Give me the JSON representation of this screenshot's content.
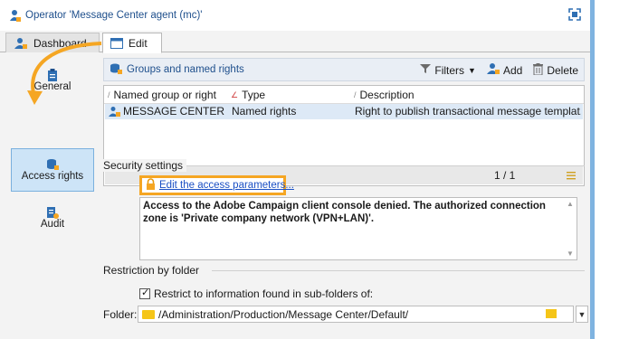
{
  "window": {
    "title": "Operator 'Message Center agent (mc)'"
  },
  "tabs": [
    {
      "label": "Dashboard"
    },
    {
      "label": "Edit"
    }
  ],
  "sidebar": {
    "items": [
      {
        "label": "General",
        "icon": "clipboard-icon"
      },
      {
        "label": "Access rights",
        "icon": "database-user-icon"
      },
      {
        "label": "Audit",
        "icon": "audit-icon"
      }
    ]
  },
  "groups": {
    "title": "Groups and named rights",
    "toolbar": {
      "filters": "Filters",
      "add": "Add",
      "delete": "Delete"
    },
    "columns": [
      "Named group or right",
      "Type",
      "Description"
    ],
    "rows": [
      {
        "name": "MESSAGE CENTER E...",
        "type": "Named rights",
        "description": "Right to publish transactional message templat..."
      }
    ],
    "pager": "1 / 1"
  },
  "security": {
    "label": "Security settings",
    "link": "Edit the access parameters...",
    "message": "Access to the Adobe Campaign client console denied. The authorized connection zone is 'Private company network (VPN+LAN)'."
  },
  "restriction": {
    "label": "Restriction by folder",
    "checkbox_label": "Restrict to information found in sub-folders of:",
    "folder_label": "Folder:",
    "folder_value": "/Administration/Production/Message Center/Default/"
  },
  "colors": {
    "highlight": "#f5a623",
    "link": "#1a4fc4",
    "title": "#1e4f8c",
    "selection": "#cde4f7"
  }
}
